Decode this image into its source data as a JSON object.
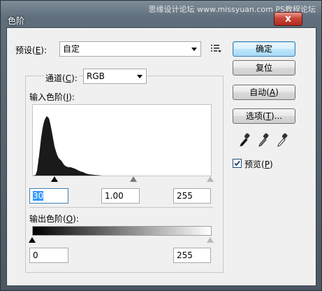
{
  "window": {
    "title": "色阶",
    "watermark": "思缘设计论坛  www.missyuan.com  PS教程论坛",
    "close_label": "x"
  },
  "preset": {
    "label_prefix": "预设(",
    "label_key": "E",
    "label_suffix": "):",
    "value": "自定"
  },
  "channel": {
    "label_prefix": "通道(",
    "label_key": "C",
    "label_suffix": "):",
    "value": "RGB"
  },
  "input_levels": {
    "label_prefix": "输入色阶(",
    "label_key": "I",
    "label_suffix": "):",
    "black": "30",
    "gamma": "1.00",
    "white": "255"
  },
  "output_levels": {
    "label_prefix": "输出色阶(",
    "label_key": "O",
    "label_suffix": "):",
    "black": "0",
    "white": "255"
  },
  "buttons": {
    "ok": "确定",
    "reset": "复位",
    "auto_prefix": "自动(",
    "auto_key": "A",
    "auto_suffix": ")",
    "options_prefix": "选项(",
    "options_key": "T",
    "options_suffix": ")..."
  },
  "preview": {
    "label_prefix": "预览(",
    "label_key": "P",
    "label_suffix": ")",
    "checked": true
  },
  "icons": {
    "preset_menu": "preset-options-icon",
    "eyedroppers": [
      "black-eyedropper-icon",
      "gray-eyedropper-icon",
      "white-eyedropper-icon"
    ]
  }
}
